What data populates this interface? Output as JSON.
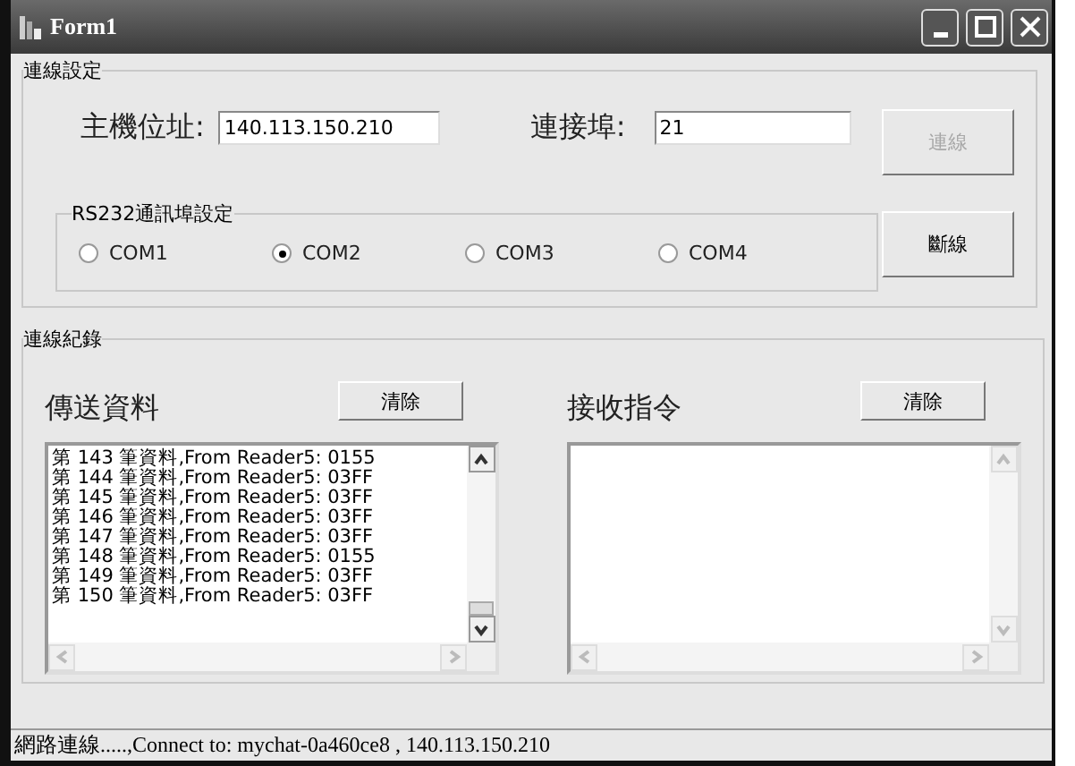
{
  "window": {
    "title": "Form1"
  },
  "connection_settings": {
    "title": "連線設定",
    "host_label": "主機位址:",
    "host_value": "140.113.150.210",
    "port_label": "連接埠:",
    "port_value": "21",
    "connect_button": {
      "label": "連線",
      "disabled": true
    },
    "disconnect_button": {
      "label": "斷線",
      "disabled": false
    },
    "rs232": {
      "title": "RS232通訊埠設定",
      "ports": [
        {
          "label": "COM1",
          "selected": false
        },
        {
          "label": "COM2",
          "selected": true
        },
        {
          "label": "COM3",
          "selected": false
        },
        {
          "label": "COM4",
          "selected": false
        }
      ]
    }
  },
  "log": {
    "title": "連線紀錄",
    "panels": [
      {
        "title": "傳送資料",
        "clear_button": "清除",
        "scrollable": true,
        "lines": [
          "第 143 筆資料,From Reader5: 0155",
          "第 144 筆資料,From Reader5: 03FF",
          "第 145 筆資料,From Reader5: 03FF",
          "第 146 筆資料,From Reader5: 03FF",
          "第 147 筆資料,From Reader5: 03FF",
          "第 148 筆資料,From Reader5: 0155",
          "第 149 筆資料,From Reader5: 03FF",
          "第 150 筆資料,From Reader5: 03FF"
        ]
      },
      {
        "title": "接收指令",
        "clear_button": "清除",
        "scrollable": false
      }
    ]
  },
  "status_bar": "網路連線.....,Connect to: mychat-0a460ce8 , 140.113.150.210"
}
